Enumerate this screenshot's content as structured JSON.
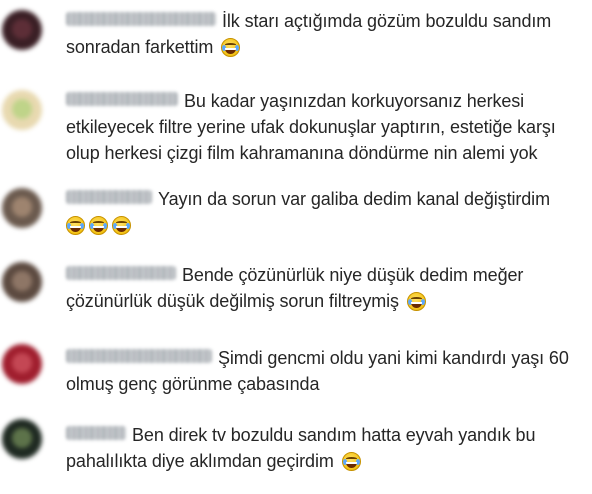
{
  "comments": [
    {
      "username": "username hidden",
      "text": "İlk starı açtığımda gözüm bozuldu sandım sonradan farkettim",
      "emoji_count": 1,
      "avatar_colors": [
        "#3a1f25",
        "#7a3b47"
      ]
    },
    {
      "username": "username hidden",
      "text": "Bu kadar yaşınızdan korkuyorsanız herkesi etkileyecek filtre yerine ufak dokunuşlar yaptırın, estetiğe karşı olup herkesi çizgi film kahramanına döndürme nin alemi yok",
      "emoji_count": 0,
      "avatar_colors": [
        "#e8d9b0",
        "#9ccf6a"
      ]
    },
    {
      "username": "username hidden",
      "text": "Yayın da sorun var galiba dedim kanal değiştirdim",
      "emoji_count": 3,
      "avatar_colors": [
        "#6b5a4e",
        "#c9a88a"
      ]
    },
    {
      "username": "username hidden",
      "text": "Bende çözünürlük niye düşük dedim meğer çözünürlük düşük değilmiş sorun filtreymiş",
      "emoji_count": 1,
      "avatar_colors": [
        "#5c4a40",
        "#b89b85"
      ]
    },
    {
      "username": "username hidden",
      "text": "Şimdi gencmi oldu yani kimi kandırdı yaşı 60 olmuş genç görünme çabasında",
      "emoji_count": 0,
      "avatar_colors": [
        "#a01e2e",
        "#e26a74"
      ]
    },
    {
      "username": "username hidden",
      "text": "Ben direk tv bozuldu sandım hatta eyvah yandık bu pahalılıkta diye aklımdan geçirdim",
      "emoji_count": 1,
      "avatar_colors": [
        "#1f2a22",
        "#8fae6c"
      ]
    }
  ],
  "emoji_name": "face-with-tears-of-joy"
}
